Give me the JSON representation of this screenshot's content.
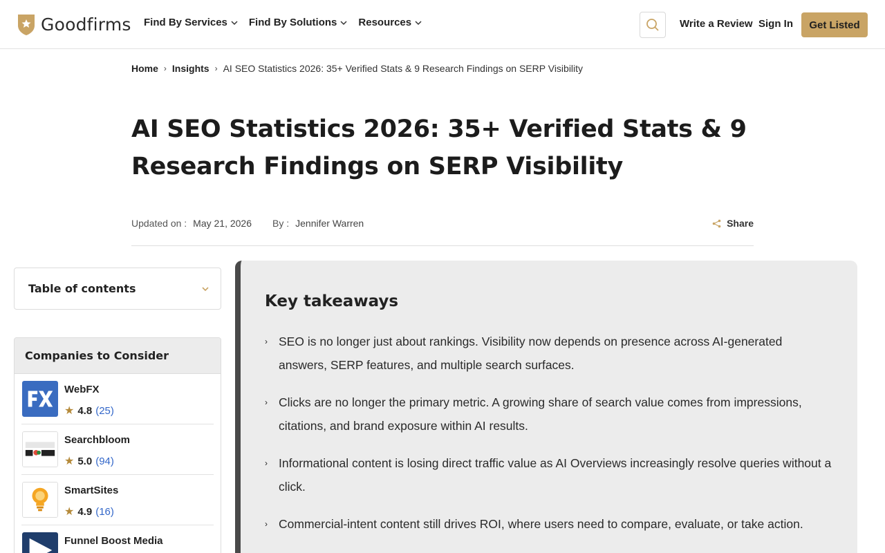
{
  "header": {
    "brand": "Goodfirms",
    "nav": [
      {
        "label": "Find By Services"
      },
      {
        "label": "Find By Solutions"
      },
      {
        "label": "Resources"
      }
    ],
    "write_review": "Write a Review",
    "sign_in": "Sign In",
    "get_listed": "Get Listed",
    "accent_color": "#c9a465"
  },
  "breadcrumb": {
    "home": "Home",
    "insights": "Insights",
    "current": "AI SEO Statistics 2026: 35+ Verified Stats & 9 Research Findings on SERP Visibility",
    "separator": "›"
  },
  "article": {
    "title": "AI SEO Statistics 2026: 35+ Verified Stats & 9 Research Findings on SERP Visibility",
    "updated_label": "Updated on :",
    "updated_value": "May 21, 2026",
    "by_label": "By :",
    "author": "Jennifer Warren",
    "share": "Share"
  },
  "sidebar": {
    "toc_label": "Table of contents",
    "companies_title": "Companies to Consider",
    "companies": [
      {
        "name": "WebFX",
        "score": "4.8",
        "count": "(25)",
        "logo": "webfx-logo"
      },
      {
        "name": "Searchbloom",
        "score": "5.0",
        "count": "(94)",
        "logo": "searchbloom-logo"
      },
      {
        "name": "SmartSites",
        "score": "4.9",
        "count": "(16)",
        "logo": "smartsites-logo"
      },
      {
        "name": "Funnel Boost Media",
        "score": "",
        "count": "",
        "logo": "funnel-boost-logo"
      }
    ],
    "star_color": "#b58a3a",
    "count_color": "#3367c9"
  },
  "key_takeaways": {
    "title": "Key takeaways",
    "items": [
      "SEO is no longer just about rankings. Visibility now depends on presence across AI-generated answers, SERP features, and multiple search surfaces.",
      "Clicks are no longer the primary metric. A growing share of search value comes from impressions, citations, and brand exposure within AI results.",
      "Informational content is losing direct traffic value as AI Overviews increasingly resolve queries without a click.",
      "Commercial-intent content still drives ROI, where users need to compare, evaluate, or take action."
    ]
  }
}
